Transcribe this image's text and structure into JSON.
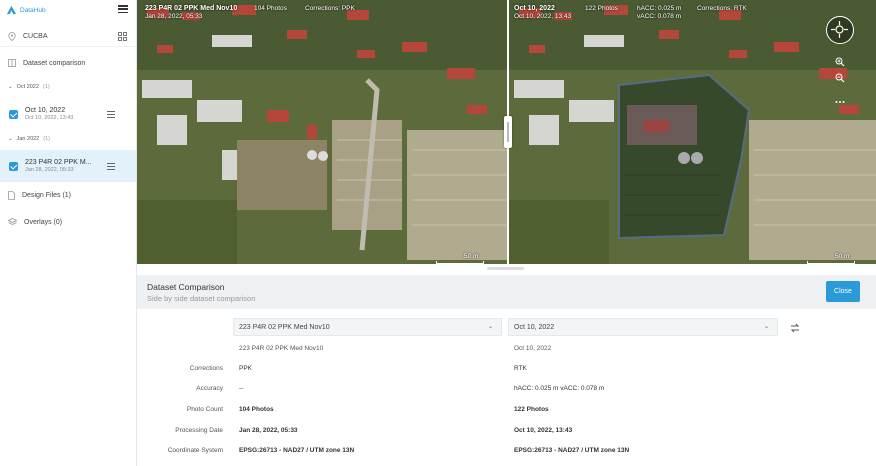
{
  "app": {
    "logo_text": "DataHub"
  },
  "sidebar": {
    "project": "CUCBA",
    "dataset_comparison": "Dataset comparison",
    "groups": [
      {
        "label": "Oct 2022",
        "count": "(1)",
        "items": [
          {
            "title": "Oct 10, 2022",
            "subtitle": "Oct 10, 2022, 13:43",
            "selected": false
          }
        ]
      },
      {
        "label": "Jan 2022",
        "count": "(1)",
        "items": [
          {
            "title": "223 P4R 02 PPK M...",
            "subtitle": "Jan 28, 2022, 05:33",
            "selected": true
          }
        ]
      }
    ],
    "design_files": "Design Files (1)",
    "overlays": "Overlays (0)"
  },
  "map_left": {
    "title": "223 P4R 02 PPK Med Nov10",
    "date": "Jan 28, 2022, 05:33",
    "photos": "104 Photos",
    "corrections": "Corrections: PPK",
    "scale": "50 m"
  },
  "map_right": {
    "title": "Oct 10, 2022",
    "date": "Oct 10, 2022, 13:43",
    "photos": "122 Photos",
    "hacc": "hACC: 0.025 m",
    "vacc": "vACC: 0.078 m",
    "corrections": "Corrections: RTK",
    "scale": "50 m"
  },
  "panel": {
    "title": "Dataset Comparison",
    "subtitle": "Side by side dataset comparison",
    "close_label": "Close",
    "left_select": "223 P4R 02 PPK Med Nov10",
    "right_select": "Oct 10, 2022",
    "left_name": "223 P4R 02 PPK Med Nov10",
    "right_name": "Oct 10, 2022",
    "rows": [
      {
        "label": "Corrections",
        "left": "PPK",
        "right": "RTK",
        "bold": false
      },
      {
        "label": "Accuracy",
        "left": "--",
        "right": "hACC: 0.025 m vACC: 0.078 m",
        "bold": false
      },
      {
        "label": "Photo Count",
        "left": "104 Photos",
        "right": "122 Photos",
        "bold": true
      },
      {
        "label": "Processing Date",
        "left": "Jan 28, 2022, 05:33",
        "right": "Oct 10, 2022, 13:43",
        "bold": true
      },
      {
        "label": "Coordinate System",
        "left": "EPSG:26713 - NAD27 / UTM zone 13N",
        "right": "EPSG:26713 - NAD27 / UTM zone 13N",
        "bold": true
      }
    ]
  },
  "colors": {
    "accent": "#2a9bd8",
    "roof_red": "#b5463a",
    "vegetation": "#3f5a2a"
  }
}
